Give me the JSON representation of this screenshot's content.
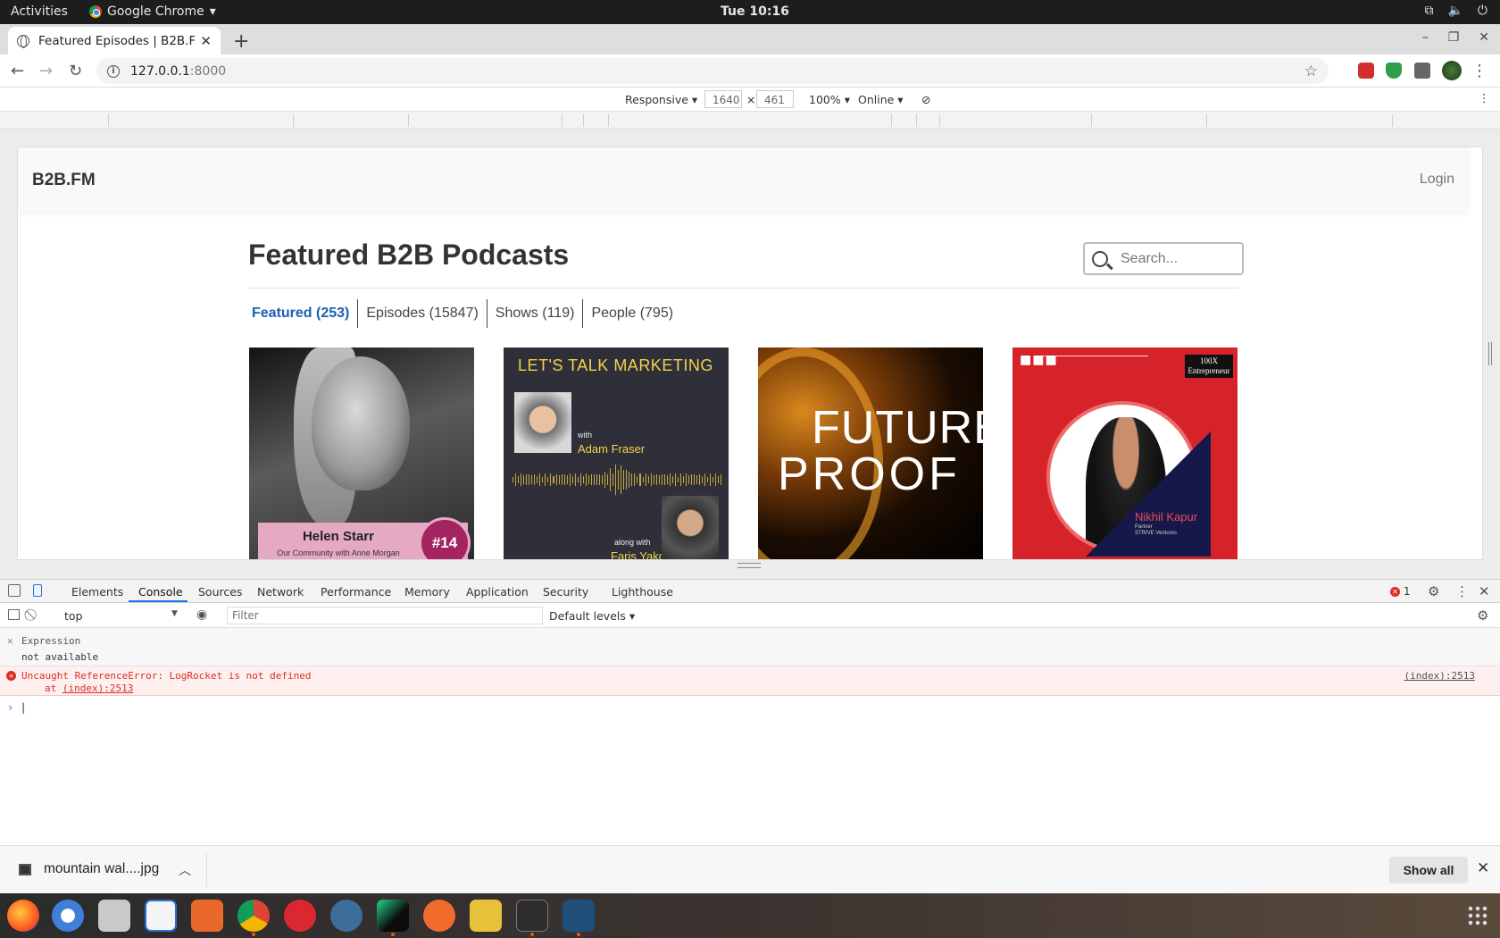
{
  "topbar": {
    "activities": "Activities",
    "app_name": "Google Chrome",
    "app_arrow": "▾",
    "clock": "Tue 10:16",
    "sys_icons": [
      "network-icon",
      "volume-icon",
      "power-icon"
    ]
  },
  "browser": {
    "tab_title": "Featured Episodes | B2B.F",
    "url_host": "127.0.0.1",
    "url_port": ":8000"
  },
  "device_toolbar": {
    "mode": "Responsive ▾",
    "width": "1640",
    "times": "×",
    "height": "461",
    "zoom": "100% ▾",
    "network": "Online ▾"
  },
  "site": {
    "brand": "B2B.FM",
    "login": "Login",
    "title": "Featured B2B Podcasts",
    "search_placeholder": "Search...",
    "tabs": [
      {
        "label": "Featured (253)",
        "active": true
      },
      {
        "label": "Episodes (15847)",
        "active": false
      },
      {
        "label": "Shows (119)",
        "active": false
      },
      {
        "label": "People (795)",
        "active": false
      }
    ],
    "cards": [
      {
        "name": "Helen Starr",
        "subtitle": "Our Community with Anne Morgan",
        "badge": "#14"
      },
      {
        "heading": "LET'S TALK MARKETING",
        "with": "with",
        "host": "Adam Fraser",
        "along": "along with",
        "guest": "Faris Yakob"
      },
      {
        "line1": "FUTURE",
        "line2": "PROOF"
      },
      {
        "logo_top": "100X",
        "logo_bottom": "Entrepreneur",
        "dots": "■■■",
        "name": "Nikhil Kapur",
        "role1": "Partner",
        "role2": "STRIVE Ventures"
      }
    ]
  },
  "devtools": {
    "tabs": [
      "Elements",
      "Console",
      "Sources",
      "Network",
      "Performance",
      "Memory",
      "Application",
      "Security",
      "Lighthouse"
    ],
    "active_tab": "Console",
    "error_count": "1",
    "context": "top",
    "filter_placeholder": "Filter",
    "levels": "Default levels ▾",
    "expression_label": "Expression",
    "expression_value": "not available",
    "error_message": "Uncaught ReferenceError: LogRocket is not defined",
    "error_at": "at ",
    "error_at_link": "(index):2513",
    "error_source": "(index):2513",
    "prompt": "›"
  },
  "downloads": {
    "filename": "mountain wal....jpg",
    "show_all": "Show all"
  },
  "colors": {
    "accent": "#1a5fb4",
    "error": "#d93025",
    "devtools_blue": "#1a73e8",
    "ubuntu_orange": "#e95420"
  }
}
